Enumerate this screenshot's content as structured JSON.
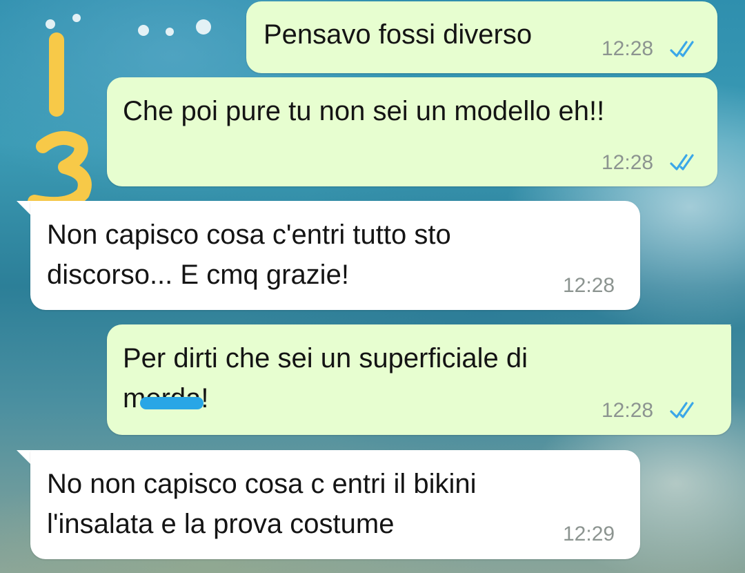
{
  "chat": {
    "messages": [
      {
        "direction": "outgoing",
        "text": "Pensavo fossi diverso",
        "time": "12:28",
        "status": "read-double-check-icon"
      },
      {
        "direction": "outgoing",
        "text": "Che poi pure tu non sei un modello eh!!",
        "time": "12:28",
        "status": "read-double-check-icon"
      },
      {
        "direction": "incoming",
        "text": "Non capisco cosa c'entri tutto sto\ndiscorso... E cmq grazie!",
        "time": "12:28"
      },
      {
        "direction": "outgoing",
        "text": "Per dirti che sei un superficiale di\nmerda!",
        "time": "12:28",
        "status": "read-double-check-icon"
      },
      {
        "direction": "incoming",
        "text": "No non capisco cosa c entri il bikini\nl'insalata e la prova costume",
        "time": "12:29"
      }
    ]
  },
  "annotations": {
    "handwritten": "1\n3",
    "redaction_color": "#28a6e6",
    "marker_color": "#f7c948"
  },
  "colors": {
    "outgoing_bubble": "#e7fed0",
    "incoming_bubble": "#ffffff",
    "read_tick": "#3aa7e8",
    "timestamp": "#8c9490"
  }
}
